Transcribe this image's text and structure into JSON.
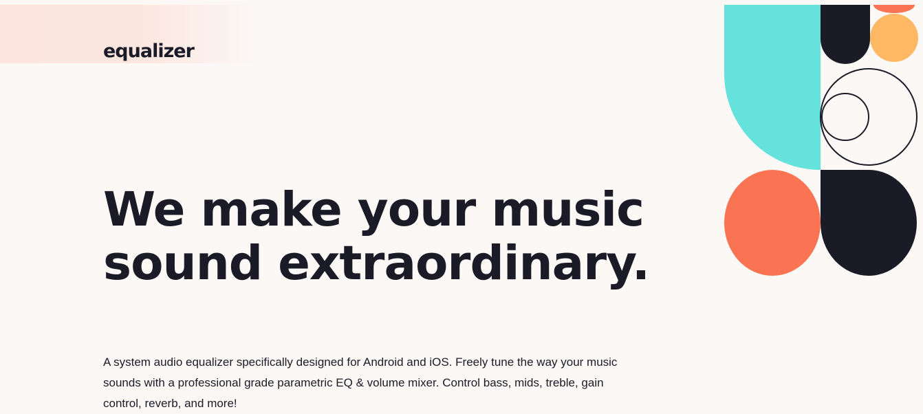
{
  "brand": {
    "logo_text": "equalizer"
  },
  "hero": {
    "headline": "We make your music sound extraordinary.",
    "description": "A system audio equalizer specifically designed for Android and iOS. Freely tune the way your music sounds with a professional grade parametric EQ & volume mixer. Control bass, mids, treble, gain control, reverb, and more!"
  },
  "colors": {
    "background": "#fbf8f6",
    "text_dark": "#1a1b26",
    "cyan": "#66e2dd",
    "coral": "#fa7453",
    "orange": "#ffb964",
    "peach_glow": "#fde6e0"
  }
}
